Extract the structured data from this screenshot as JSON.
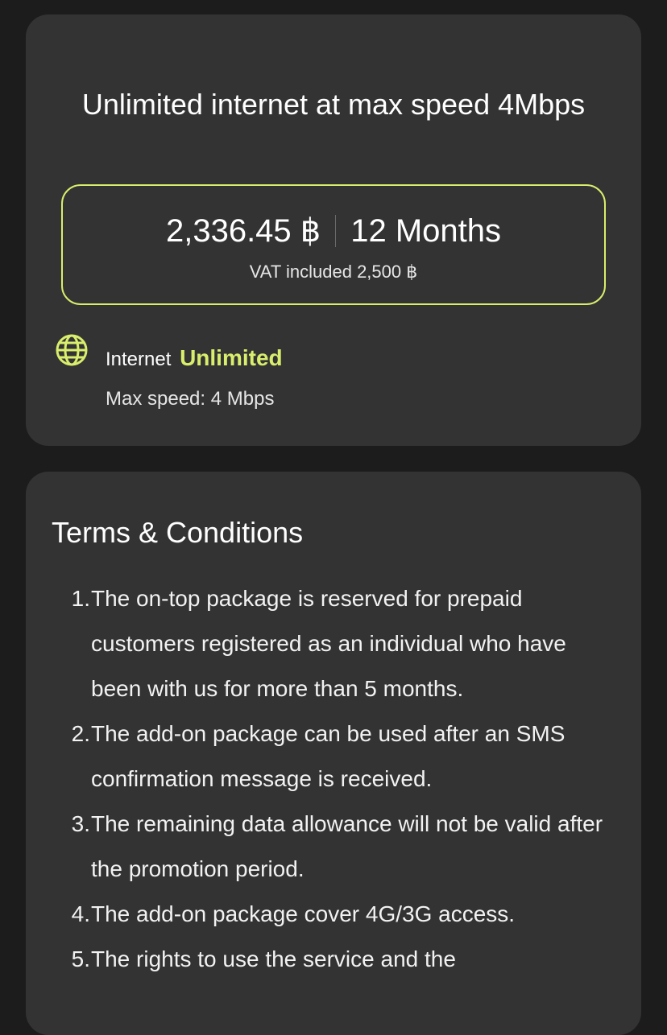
{
  "package": {
    "title": "Unlimited internet at max speed 4Mbps",
    "price": "2,336.45 ฿",
    "duration": "12 Months",
    "vat_line": "VAT included 2,500 ฿",
    "feature": {
      "icon": "globe-icon",
      "label": "Internet",
      "value": "Unlimited",
      "subtext": "Max speed: 4 Mbps"
    },
    "accent_color": "#d8ee6c"
  },
  "terms": {
    "title": "Terms & Conditions",
    "items": [
      {
        "num": "1.",
        "text": "The on-top package is reserved for prepaid customers registered as an individual who have been with us for more than 5 months."
      },
      {
        "num": "2.",
        "text": "The add-on package can be used after an SMS confirmation message is received."
      },
      {
        "num": "3.",
        "text": "The remaining data allowance will not be valid after the promotion period."
      },
      {
        "num": "4.",
        "text": "The add-on package cover 4G/3G access."
      },
      {
        "num": "5.",
        "text": "The rights to use the service and the"
      }
    ]
  }
}
